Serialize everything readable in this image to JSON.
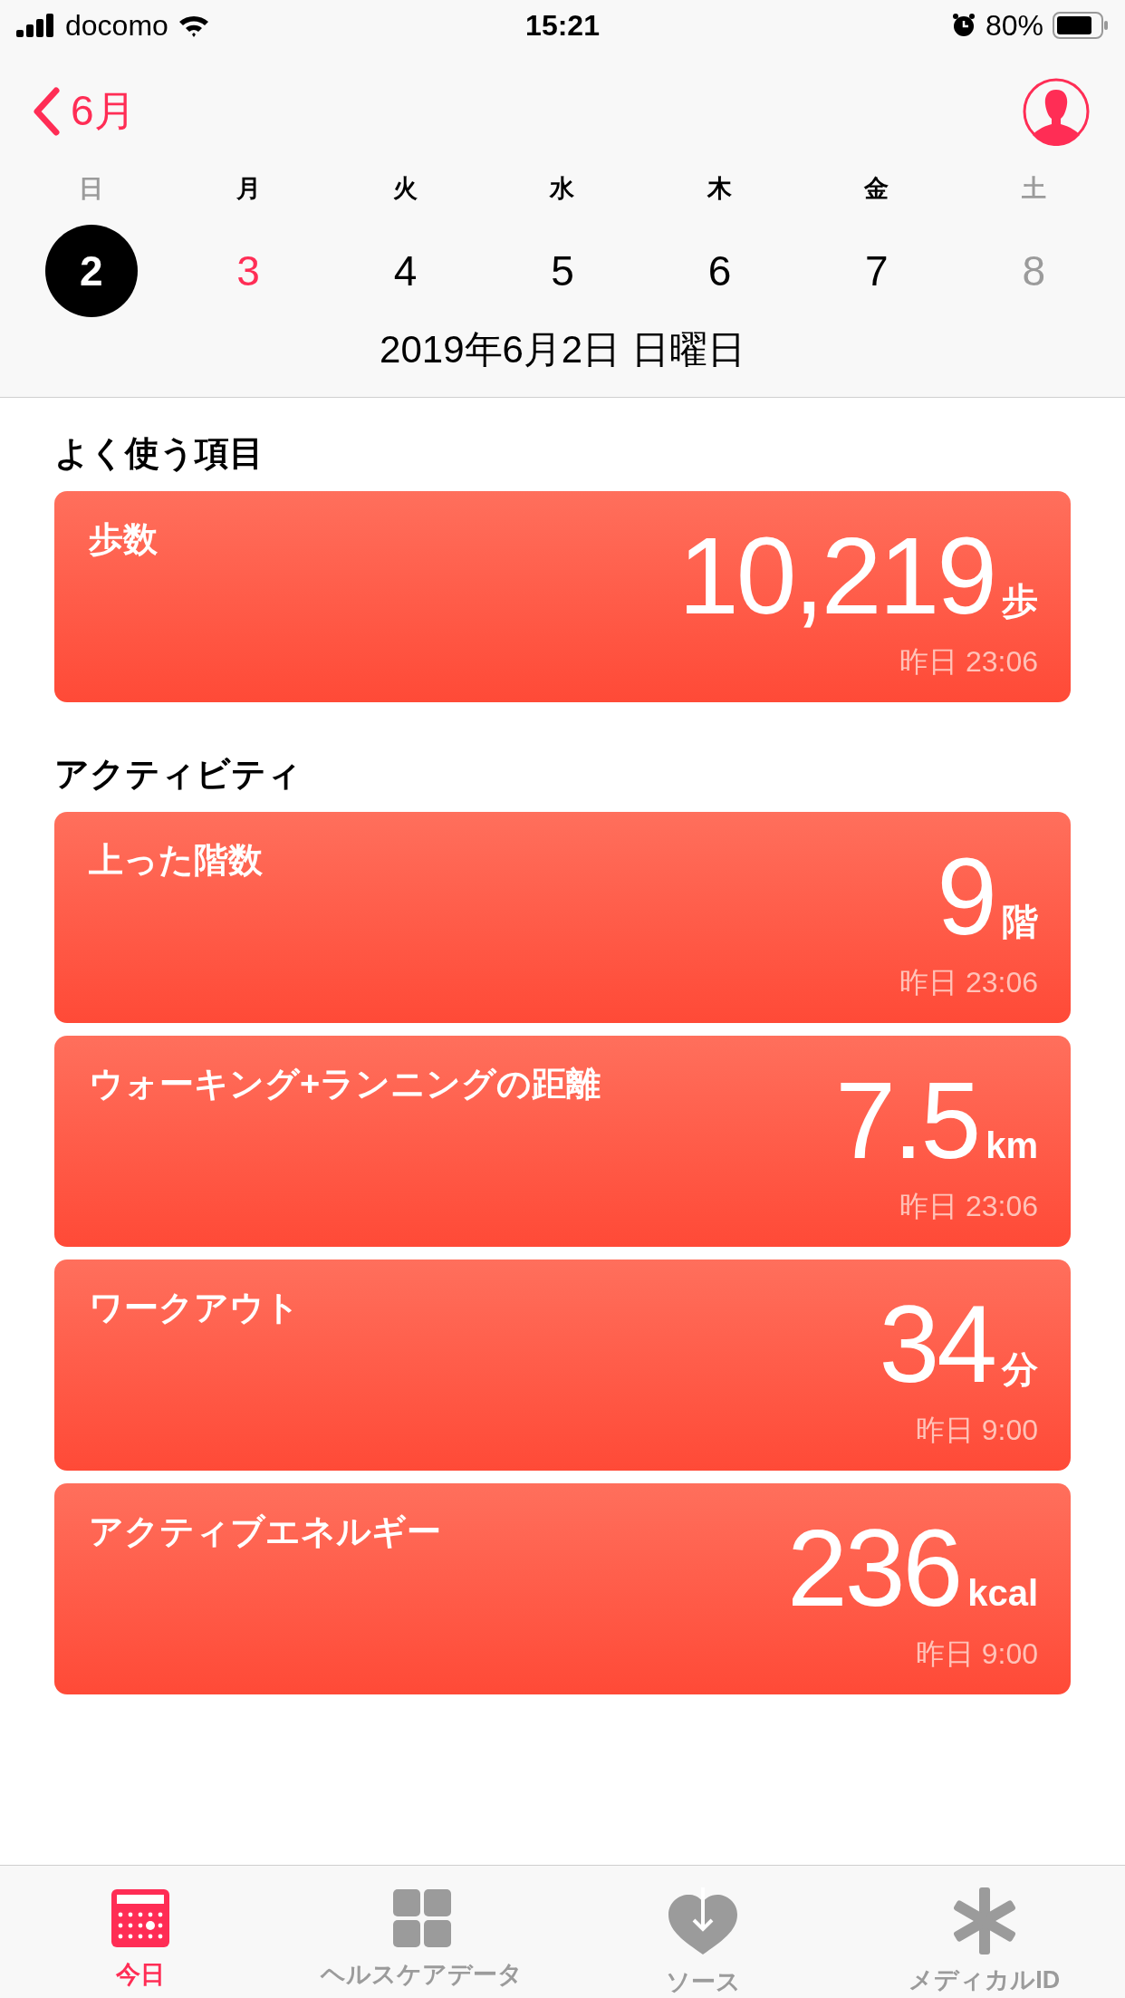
{
  "status_bar": {
    "carrier": "docomo",
    "time": "15:21",
    "battery": "80%"
  },
  "nav": {
    "back_label": "6月"
  },
  "week": [
    {
      "label": "日",
      "number": "2",
      "weekend": true,
      "today": false,
      "selected": true
    },
    {
      "label": "月",
      "number": "3",
      "weekend": false,
      "today": true,
      "selected": false
    },
    {
      "label": "火",
      "number": "4",
      "weekend": false,
      "today": false,
      "selected": false
    },
    {
      "label": "水",
      "number": "5",
      "weekend": false,
      "today": false,
      "selected": false
    },
    {
      "label": "木",
      "number": "6",
      "weekend": false,
      "today": false,
      "selected": false
    },
    {
      "label": "金",
      "number": "7",
      "weekend": false,
      "today": false,
      "selected": false
    },
    {
      "label": "土",
      "number": "8",
      "weekend": true,
      "today": false,
      "selected": false
    }
  ],
  "date_title": "2019年6月2日 日曜日",
  "sections": [
    {
      "title": "よく使う項目",
      "cards": [
        {
          "title": "歩数",
          "value": "10,219",
          "unit": "歩",
          "time": "昨日 23:06"
        }
      ]
    },
    {
      "title": "アクティビティ",
      "cards": [
        {
          "title": "上った階数",
          "value": "9",
          "unit": "階",
          "time": "昨日 23:06"
        },
        {
          "title": "ウォーキング+ランニングの距離",
          "value": "7.5",
          "unit": "km",
          "time": "昨日 23:06"
        },
        {
          "title": "ワークアウト",
          "value": "34",
          "unit": "分",
          "time": "昨日 9:00"
        },
        {
          "title": "アクティブエネルギー",
          "value": "236",
          "unit": "kcal",
          "time": "昨日 9:00"
        }
      ]
    }
  ],
  "tabs": [
    {
      "label": "今日",
      "selected": true
    },
    {
      "label": "ヘルスケアデータ",
      "selected": false
    },
    {
      "label": "ソース",
      "selected": false
    },
    {
      "label": "メディカルID",
      "selected": false
    }
  ]
}
